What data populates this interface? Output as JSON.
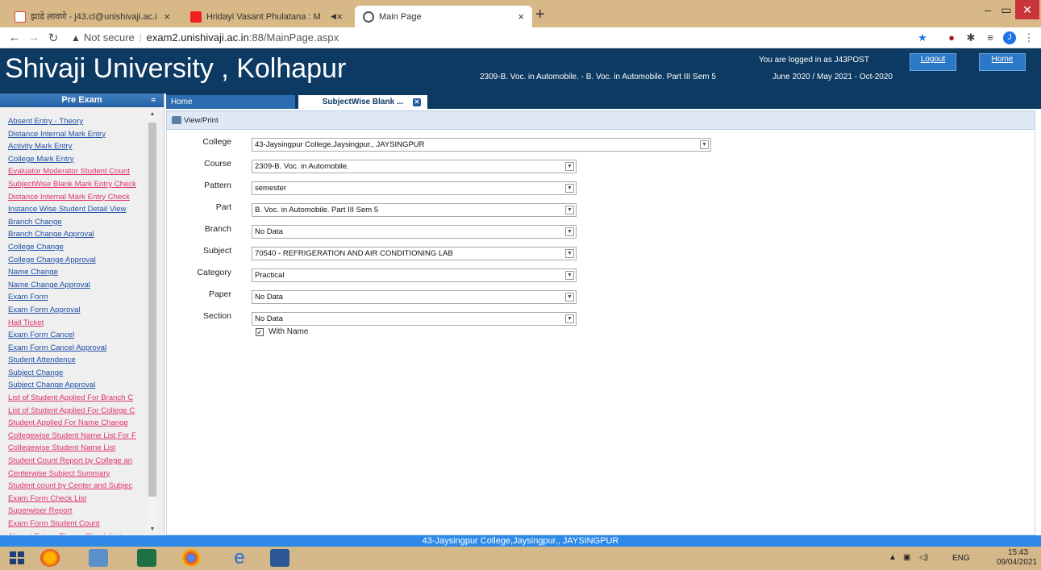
{
  "browser": {
    "tabs": [
      {
        "label": "झाडे लावणे - j43.cl@unishivaji.ac.i",
        "active": false,
        "icon": "gmail-icon"
      },
      {
        "label": "Hridayi Vasant Phulatana : M",
        "active": false,
        "icon": "youtube-icon"
      },
      {
        "label": "Main Page",
        "active": true,
        "icon": "globe-icon"
      }
    ],
    "new_tab": "+",
    "url_warning": "Not secure",
    "url_host": "exam2.unishivaji.ac.in",
    "url_rest": ":88/MainPage.aspx",
    "profile_initial": "J"
  },
  "header": {
    "brand": "Shivaji University , Kolhapur",
    "course_info": "2309-B. Voc. in Automobile. - B. Voc. in Automobile. Part III Sem 5",
    "login_msg": "You are logged in as J43POST",
    "session": "June 2020 / May 2021 - Oct-2020",
    "logout_label": "Logout",
    "home_label": "Home"
  },
  "sidebar": {
    "title": "Pre Exam",
    "items": [
      {
        "label": "Absent Entry - Theory",
        "color": "#1f4fa8"
      },
      {
        "label": "Distance Internal Mark Entry",
        "color": "#1f4fa8"
      },
      {
        "label": "Activity Mark Entry",
        "color": "#1f4fa8"
      },
      {
        "label": "College Mark Entry",
        "color": "#1f4fa8"
      },
      {
        "label": "Evaluator Moderator Student Count",
        "color": "#e0336c"
      },
      {
        "label": "SubjectWise Blank Mark Entry Check",
        "color": "#e0336c"
      },
      {
        "label": "Distance Internal Mark Entry Check",
        "color": "#e0336c"
      },
      {
        "label": "Instance Wise Student Detail View",
        "color": "#1f4fa8"
      },
      {
        "label": "Branch Change",
        "color": "#1f4fa8"
      },
      {
        "label": "Branch Change Approval",
        "color": "#1f4fa8"
      },
      {
        "label": "College Change",
        "color": "#1f4fa8"
      },
      {
        "label": "College Change Approval",
        "color": "#1f4fa8"
      },
      {
        "label": "Name Change",
        "color": "#1f4fa8"
      },
      {
        "label": "Name Change Approval",
        "color": "#1f4fa8"
      },
      {
        "label": "Exam Form",
        "color": "#1f4fa8"
      },
      {
        "label": "Exam Form Approval",
        "color": "#1f4fa8"
      },
      {
        "label": "Hall Ticket",
        "color": "#e0336c"
      },
      {
        "label": "Exam Form Cancel",
        "color": "#1f4fa8"
      },
      {
        "label": "Exam Form Cancel Approval",
        "color": "#1f4fa8"
      },
      {
        "label": "Student Attendence",
        "color": "#1f4fa8"
      },
      {
        "label": "Subject Change",
        "color": "#1f4fa8"
      },
      {
        "label": "Subject Change Approval",
        "color": "#1f4fa8"
      },
      {
        "label": "List of Student Applied For Branch C",
        "color": "#e0336c"
      },
      {
        "label": "List of Student Applied For College C",
        "color": "#e0336c"
      },
      {
        "label": "Student Applied For Name Change",
        "color": "#e0336c"
      },
      {
        "label": "Collegewise Student Name List For F",
        "color": "#e0336c"
      },
      {
        "label": "Collegewise Student Name List",
        "color": "#e0336c"
      },
      {
        "label": "Student Count Report by College an",
        "color": "#e0336c"
      },
      {
        "label": "Centerwise Subject Summary",
        "color": "#e0336c"
      },
      {
        "label": "Student count by Center and Subjec",
        "color": "#e0336c"
      },
      {
        "label": "Exam Form Check List",
        "color": "#e0336c"
      },
      {
        "label": "Superwiser Report",
        "color": "#e0336c"
      },
      {
        "label": "Exam Form Student Count",
        "color": "#e0336c"
      },
      {
        "label": "Absent Entry - Theory Check List",
        "color": "#e0336c"
      }
    ]
  },
  "tabs": {
    "home": "Home",
    "active": "SubjectWise Blank  ..."
  },
  "toolbar": {
    "view_print": "View/Print"
  },
  "form": {
    "fields": [
      {
        "label": "College",
        "value": "43-Jaysingpur College,Jaysingpur., JAYSINGPUR"
      },
      {
        "label": "Course",
        "value": "2309-B. Voc. in Automobile."
      },
      {
        "label": "Pattern",
        "value": "semester"
      },
      {
        "label": "Part",
        "value": "B. Voc. in Automobile. Part III Sem 5"
      },
      {
        "label": "Branch",
        "value": "No Data"
      },
      {
        "label": "Subject",
        "value": "70540 - REFRIGERATION AND AIR CONDITIONING LAB"
      },
      {
        "label": "Category",
        "value": "Practical"
      },
      {
        "label": "Paper",
        "value": "No Data"
      },
      {
        "label": "Section",
        "value": "No Data"
      }
    ],
    "with_name_label": "With Name",
    "with_name_checked": true
  },
  "status": {
    "college": "43-Jaysingpur College,Jaysingpur., JAYSINGPUR"
  },
  "taskbar": {
    "lang": "ENG",
    "time": "15:43",
    "date": "09/04/2021"
  }
}
